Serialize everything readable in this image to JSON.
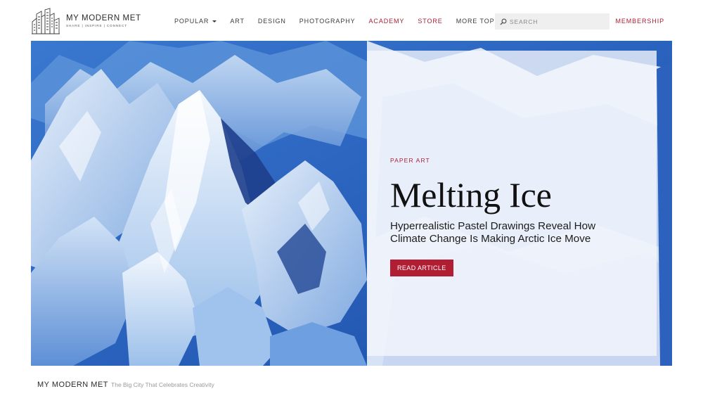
{
  "site": {
    "name": "MY MODERN MET",
    "tagline": "SHARE | INSPIRE | CONNECT"
  },
  "nav": {
    "items": [
      {
        "label": "POPULAR",
        "dropdown": true,
        "accent": false
      },
      {
        "label": "ART",
        "dropdown": false,
        "accent": false
      },
      {
        "label": "DESIGN",
        "dropdown": false,
        "accent": false
      },
      {
        "label": "PHOTOGRAPHY",
        "dropdown": false,
        "accent": false
      },
      {
        "label": "ACADEMY",
        "dropdown": false,
        "accent": true
      },
      {
        "label": "STORE",
        "dropdown": false,
        "accent": true
      },
      {
        "label": "MORE TOPICS",
        "dropdown": true,
        "accent": false
      }
    ],
    "search_placeholder": "SEARCH",
    "membership_label": "MEMBERSHIP"
  },
  "hero": {
    "category": "PAPER ART",
    "title": "Melting Ice",
    "subtitle_line1": "Hyperrealistic Pastel Drawings Reveal How",
    "subtitle_line2": "Climate Change Is Making Arctic Ice Move",
    "button_label": "READ ARTICLE",
    "image_icon": "glacier-ice-image"
  },
  "footer": {
    "brand": "MY MODERN MET",
    "tagline": "The Big City That Celebrates Creativity"
  },
  "colors": {
    "accent": "#a81f34",
    "button": "#b11e33",
    "ice_deep": "#2456b8",
    "ice_light": "#dfeaf8"
  }
}
